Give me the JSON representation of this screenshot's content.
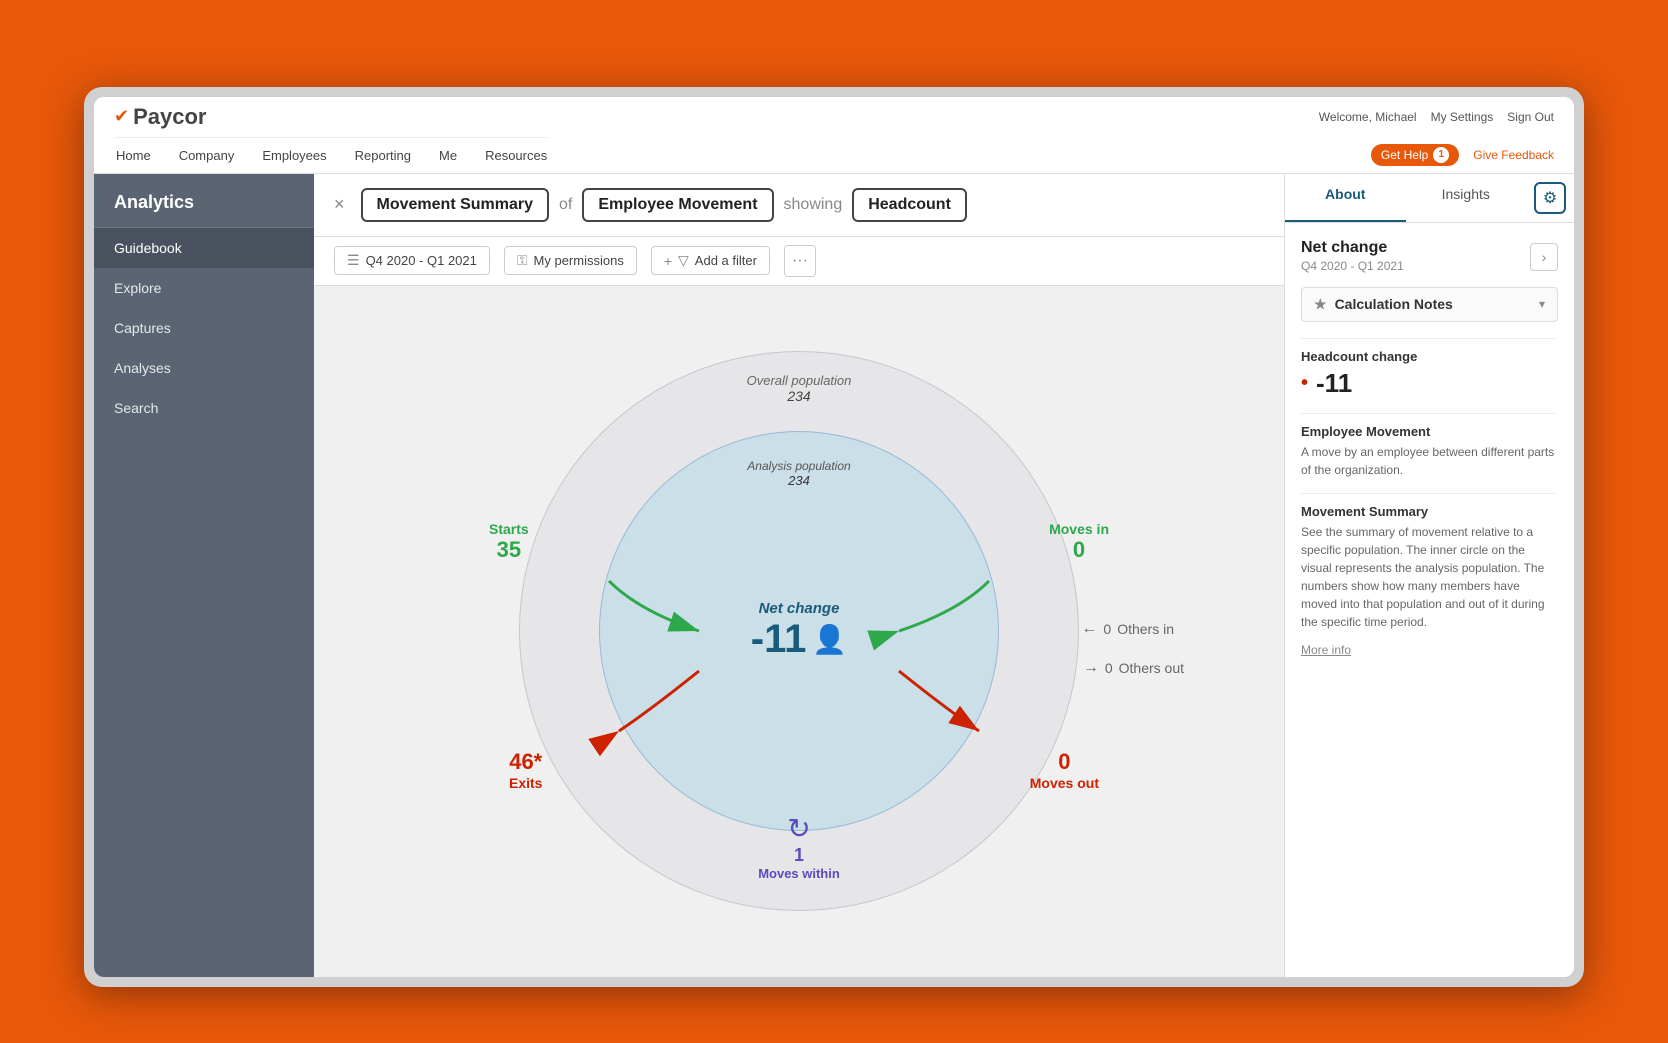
{
  "browser": {
    "top_links": [
      "Welcome, Michael",
      "My Settings",
      "Sign Out"
    ],
    "logo": "Paycor",
    "nav": [
      "Home",
      "Company",
      "Employees",
      "Reporting",
      "Me",
      "Resources"
    ],
    "get_help_label": "Get Help",
    "get_help_count": "1",
    "give_feedback_label": "Give Feedback"
  },
  "sidebar": {
    "title": "Analytics",
    "items": [
      {
        "label": "Guidebook",
        "active": true
      },
      {
        "label": "Explore",
        "active": false
      },
      {
        "label": "Captures",
        "active": false
      },
      {
        "label": "Analyses",
        "active": false
      },
      {
        "label": "Search",
        "active": false
      }
    ]
  },
  "title_bar": {
    "close_label": "×",
    "movement_summary": "Movement Summary",
    "of_label": "of",
    "employee_movement": "Employee Movement",
    "showing_label": "showing",
    "headcount": "Headcount"
  },
  "filter_bar": {
    "date_range": "Q4 2020 - Q1 2021",
    "permissions": "My permissions",
    "add_filter": "Add a filter",
    "more": "···"
  },
  "diagram": {
    "overall_population_label": "Overall population",
    "overall_population_value": "234",
    "analysis_population_label": "Analysis population",
    "analysis_population_value": "234",
    "net_change_label": "Net change",
    "net_change_value": "-11",
    "starts_label": "Starts",
    "starts_value": "35",
    "moves_in_label": "Moves in",
    "moves_in_value": "0",
    "exits_label": "Exits",
    "exits_value": "46*",
    "moves_out_label": "Moves out",
    "moves_out_value": "0",
    "others_in_label": "Others in",
    "others_in_value": "0",
    "others_out_label": "Others out",
    "others_out_value": "0",
    "moves_within_label": "Moves within",
    "moves_within_value": "1"
  },
  "right_panel": {
    "tab_about": "About",
    "tab_insights": "Insights",
    "title": "Net change",
    "subtitle": "Q4 2020 - Q1 2021",
    "calculation_notes_label": "Calculation Notes",
    "headcount_change_label": "Headcount change",
    "headcount_change_value": "-11",
    "employee_movement_label": "Employee Movement",
    "employee_movement_desc": "A move by an employee between different parts of the organization.",
    "movement_summary_label": "Movement Summary",
    "movement_summary_desc": "See the summary of movement relative to a specific population. The inner circle on the visual represents the analysis population. The numbers show how many members have moved into that population and out of it during the specific time period.",
    "more_info_label": "More info"
  }
}
